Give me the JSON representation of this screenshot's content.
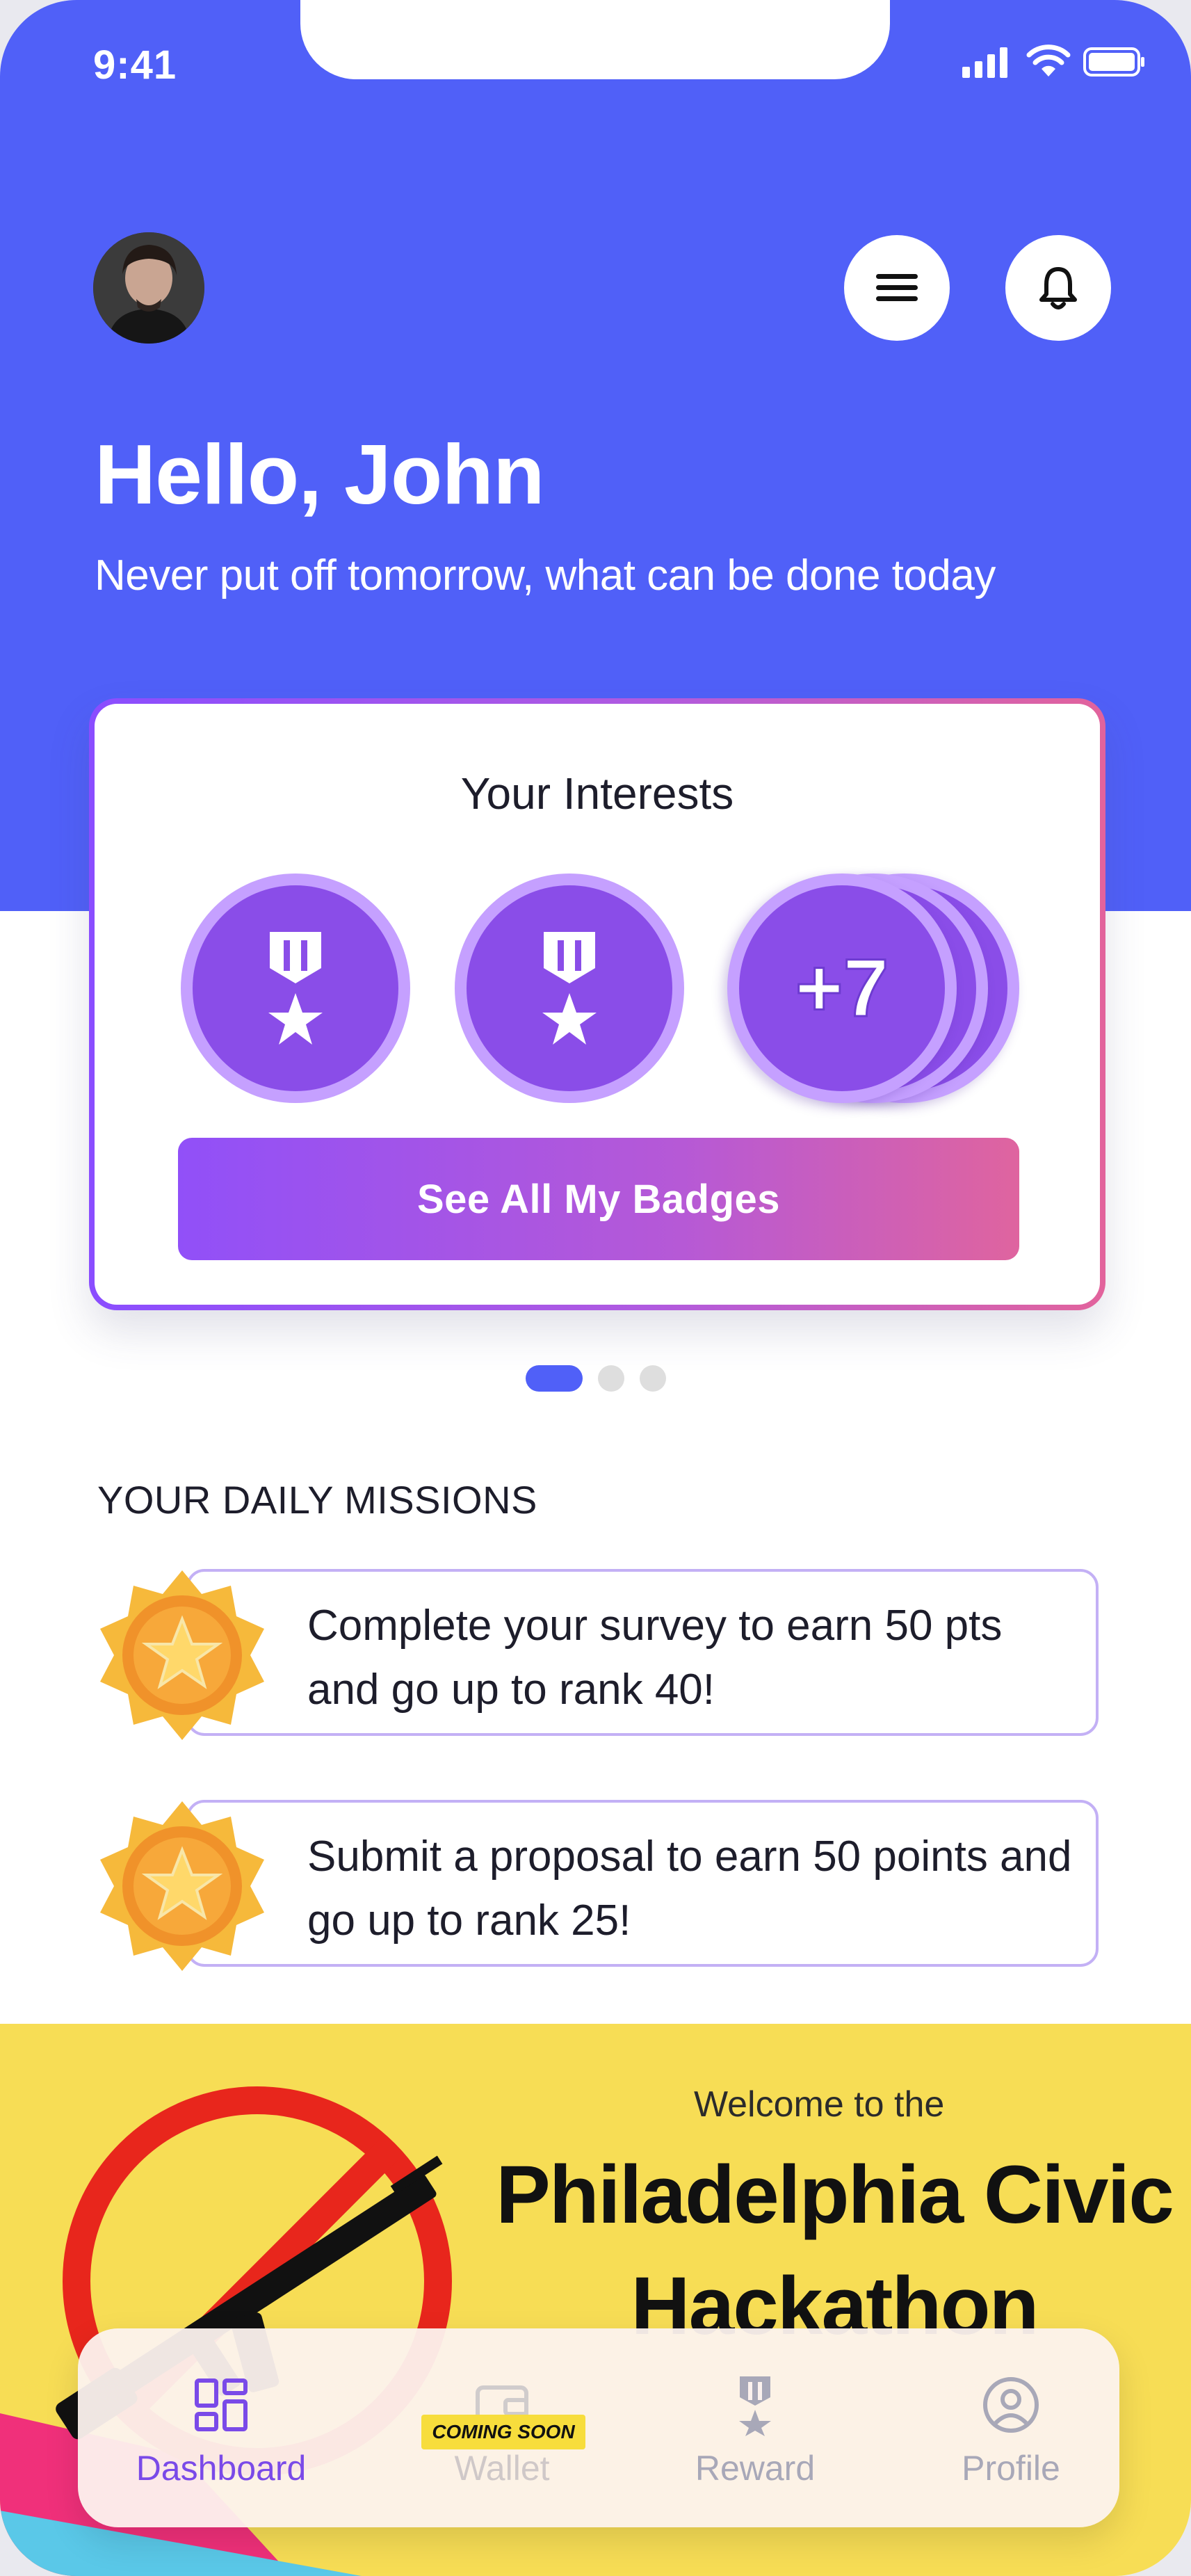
{
  "status_bar": {
    "time": "9:41"
  },
  "header": {
    "greeting": "Hello, John",
    "quote": "Never put off tomorrow, what can be done today"
  },
  "interests": {
    "title": "Your Interests",
    "more_count": "+7",
    "button_label": "See All My Badges",
    "carousel_pages": 3,
    "carousel_active": 1
  },
  "missions": {
    "title": "YOUR DAILY MISSIONS",
    "items": [
      {
        "text": "Complete your survey to earn 50 pts and go up to rank 40!"
      },
      {
        "text": "Submit a proposal to earn 50 points and go up to rank 25!"
      }
    ]
  },
  "banner": {
    "subtitle": "Welcome to the",
    "title": "Philadelphia Civic Hackathon"
  },
  "bottom_nav": {
    "items": [
      {
        "label": "Dashboard",
        "icon": "dashboard-icon",
        "active": true
      },
      {
        "label": "Wallet",
        "icon": "wallet-icon",
        "badge": "COMING SOON"
      },
      {
        "label": "Reward",
        "icon": "reward-icon"
      },
      {
        "label": "Profile",
        "icon": "profile-icon"
      }
    ]
  },
  "colors": {
    "primary": "#5060f8",
    "accent_purple": "#8a4de8",
    "gradient_end": "#e2639c",
    "banner_yellow": "#f7dd55",
    "nav_active": "#7a4ae8"
  }
}
